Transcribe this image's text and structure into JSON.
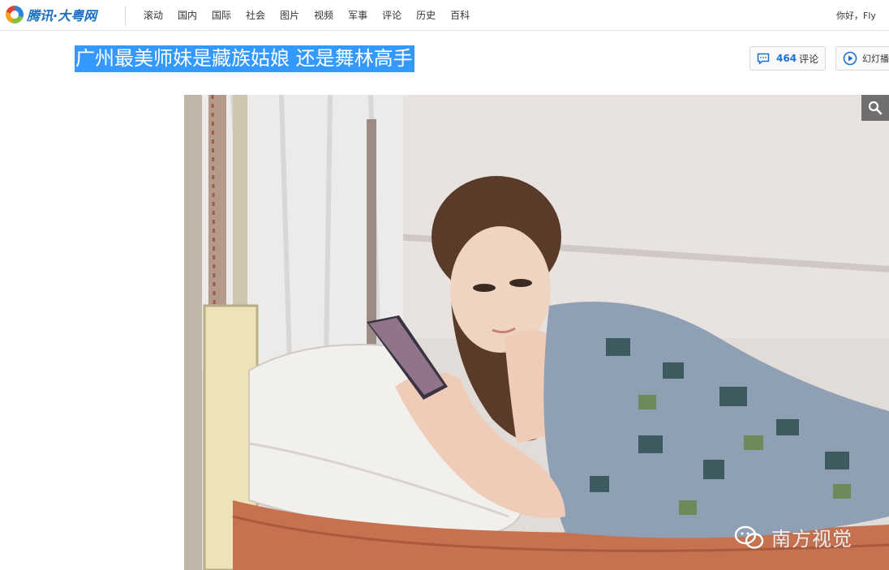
{
  "site": {
    "logo_text": "腾讯·大粤网"
  },
  "nav": {
    "items": [
      "滚动",
      "国内",
      "国际",
      "社会",
      "图片",
      "视频",
      "军事",
      "评论",
      "历史",
      "百科"
    ]
  },
  "user": {
    "greeting": "你好，Fly"
  },
  "article": {
    "title": "广州最美师妹是藏族姑娘 还是舞林高手"
  },
  "comments": {
    "count": "464",
    "label": "评论"
  },
  "slideshow": {
    "label": "幻灯播"
  },
  "photo": {
    "watermark": "南方视觉",
    "icons": {
      "zoom": "search-icon",
      "watermark": "wechat-icon"
    }
  },
  "colors": {
    "title_highlight": "#3399ff",
    "comment_count": "#1d6fd0",
    "brand": "#1a6fc7"
  }
}
